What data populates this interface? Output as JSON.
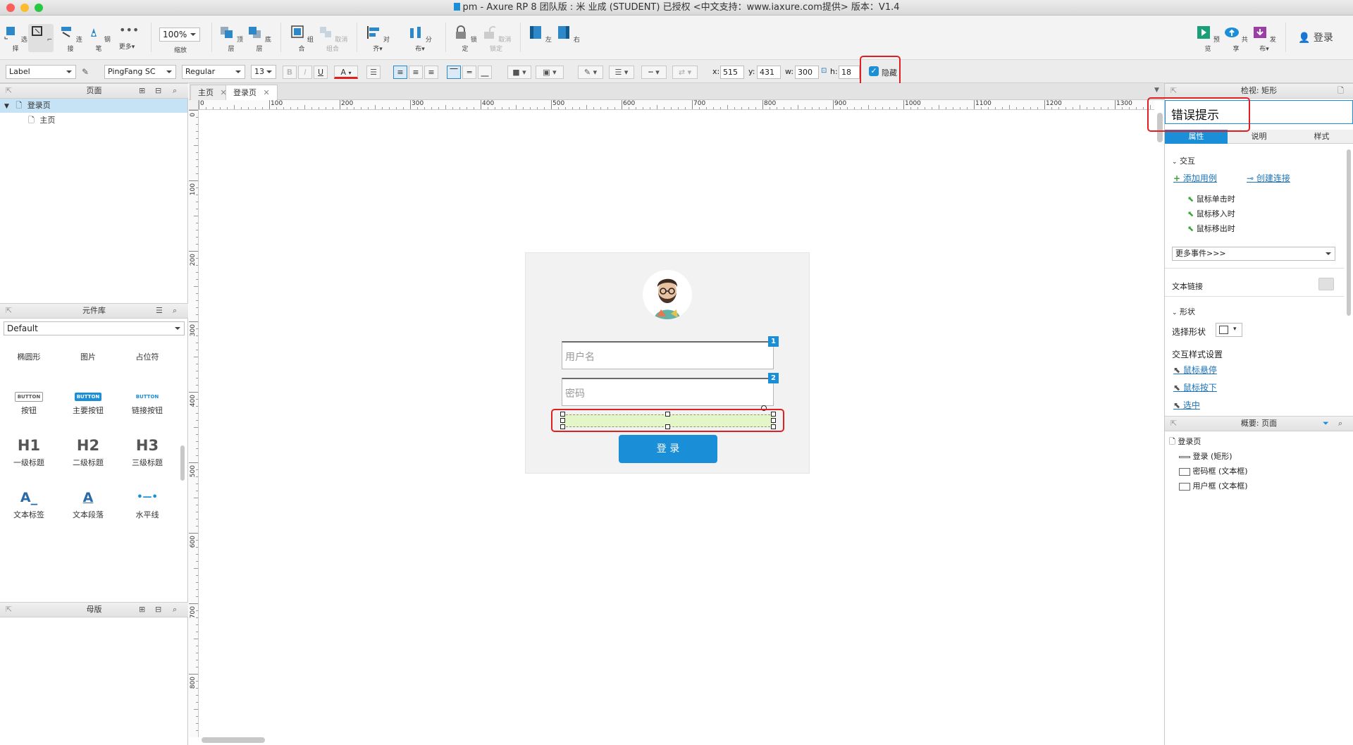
{
  "window": {
    "title": "pm - Axure RP 8 团队版 : 米 业成 (STUDENT) 已授权     <中文支持：www.iaxure.com提供> 版本：V1.4"
  },
  "toolbar": {
    "select": "选择",
    "connect": "连接",
    "pen": "钢笔",
    "more": "更多▾",
    "zoom_value": "100%",
    "zoom_label": "缩放",
    "top": "顶层",
    "bottom": "底层",
    "group": "组合",
    "ungroup": "取消组合",
    "align": "对齐▾",
    "distribute": "分布▾",
    "lock": "锁定",
    "unlock": "取消锁定",
    "left": "左",
    "right": "右",
    "preview": "预览",
    "share": "共享",
    "publish": "发布▾",
    "login": "登录"
  },
  "format": {
    "style": "Label",
    "font": "PingFang SC",
    "weight": "Regular",
    "size": "13",
    "bold": "B",
    "italic": "I",
    "underline": "U",
    "font_color": "A",
    "x_label": "x:",
    "x": "515",
    "y_label": "y:",
    "y": "431",
    "w_label": "w:",
    "w": "300",
    "h_label": "h:",
    "h": "18",
    "hidden_label": "隐藏",
    "hidden_checked": true
  },
  "pages": {
    "title": "页面",
    "items": [
      "登录页",
      "主页"
    ]
  },
  "library": {
    "title": "元件库",
    "selected": "Default",
    "items": [
      {
        "glyph": "",
        "label": "椭圆形"
      },
      {
        "glyph": "",
        "label": "图片"
      },
      {
        "glyph": "",
        "label": "占位符"
      },
      {
        "glyph": "BUTTON",
        "label": "按钮"
      },
      {
        "glyph": "BUTTON",
        "label": "主要按钮"
      },
      {
        "glyph": "BUTTON",
        "label": "链接按钮"
      },
      {
        "glyph": "H1",
        "label": "一级标题"
      },
      {
        "glyph": "H2",
        "label": "二级标题"
      },
      {
        "glyph": "H3",
        "label": "三级标题"
      },
      {
        "glyph": "A_",
        "label": "文本标签"
      },
      {
        "glyph": "A",
        "label": "文本段落"
      },
      {
        "glyph": "•—•",
        "label": "水平线"
      }
    ]
  },
  "masters": {
    "title": "母版"
  },
  "tabs": [
    {
      "label": "主页"
    },
    {
      "label": "登录页"
    }
  ],
  "ruler": {
    "h": [
      "0",
      "100",
      "200",
      "300",
      "400",
      "500",
      "600",
      "700",
      "800",
      "900",
      "1000",
      "1100",
      "1200",
      "1300"
    ],
    "v": [
      "0",
      "100",
      "200",
      "300",
      "400",
      "500",
      "600",
      "700",
      "800"
    ]
  },
  "login_card": {
    "username_placeholder": "用户名",
    "password_placeholder": "密码",
    "badge1": "1",
    "badge2": "2",
    "login_button": "登 录"
  },
  "inspector": {
    "header": "检视: 矩形",
    "name_value": "错误提示",
    "tabs": [
      "属性",
      "说明",
      "样式"
    ],
    "interaction": "交互",
    "add_case": "添加用例",
    "create_link": "创建连接",
    "events": [
      "鼠标单击时",
      "鼠标移入时",
      "鼠标移出时"
    ],
    "more_events": "更多事件>>>",
    "text_link": "文本链接",
    "shape": "形状",
    "select_shape": "选择形状",
    "interaction_style": "交互样式设置",
    "style_links": [
      "鼠标悬停",
      "鼠标按下",
      "选中"
    ]
  },
  "outline": {
    "header": "概要: 页面",
    "items": [
      "登录页",
      "登录 (矩形)",
      "密码框 (文本框)",
      "用户框 (文本框)"
    ]
  },
  "colors": {
    "accent": "#1a8fd8",
    "highlight": "#e02020",
    "selection": "#c5e3f5"
  }
}
